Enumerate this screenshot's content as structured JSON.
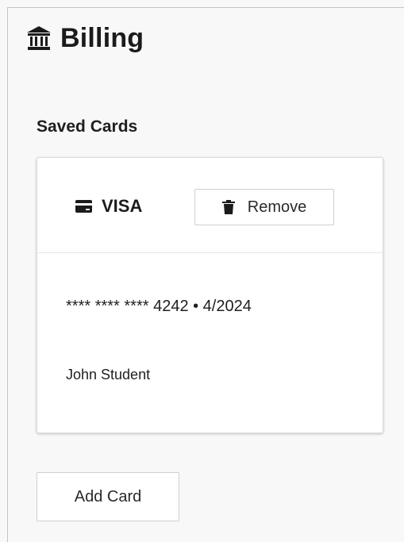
{
  "page": {
    "title": "Billing",
    "title_icon": "bank-icon"
  },
  "saved_cards": {
    "section_title": "Saved Cards",
    "cards": [
      {
        "brand": "VISA",
        "brand_icon": "credit-card-icon",
        "remove_label": "Remove",
        "remove_icon": "trash-icon",
        "number_line": "**** **** **** 4242 • 4/2024",
        "holder": "John Student"
      }
    ]
  },
  "actions": {
    "add_card_label": "Add Card"
  },
  "colors": {
    "background": "#f8f8f8",
    "text": "#212121",
    "panel": "#ffffff",
    "border": "#cfcfcf"
  }
}
